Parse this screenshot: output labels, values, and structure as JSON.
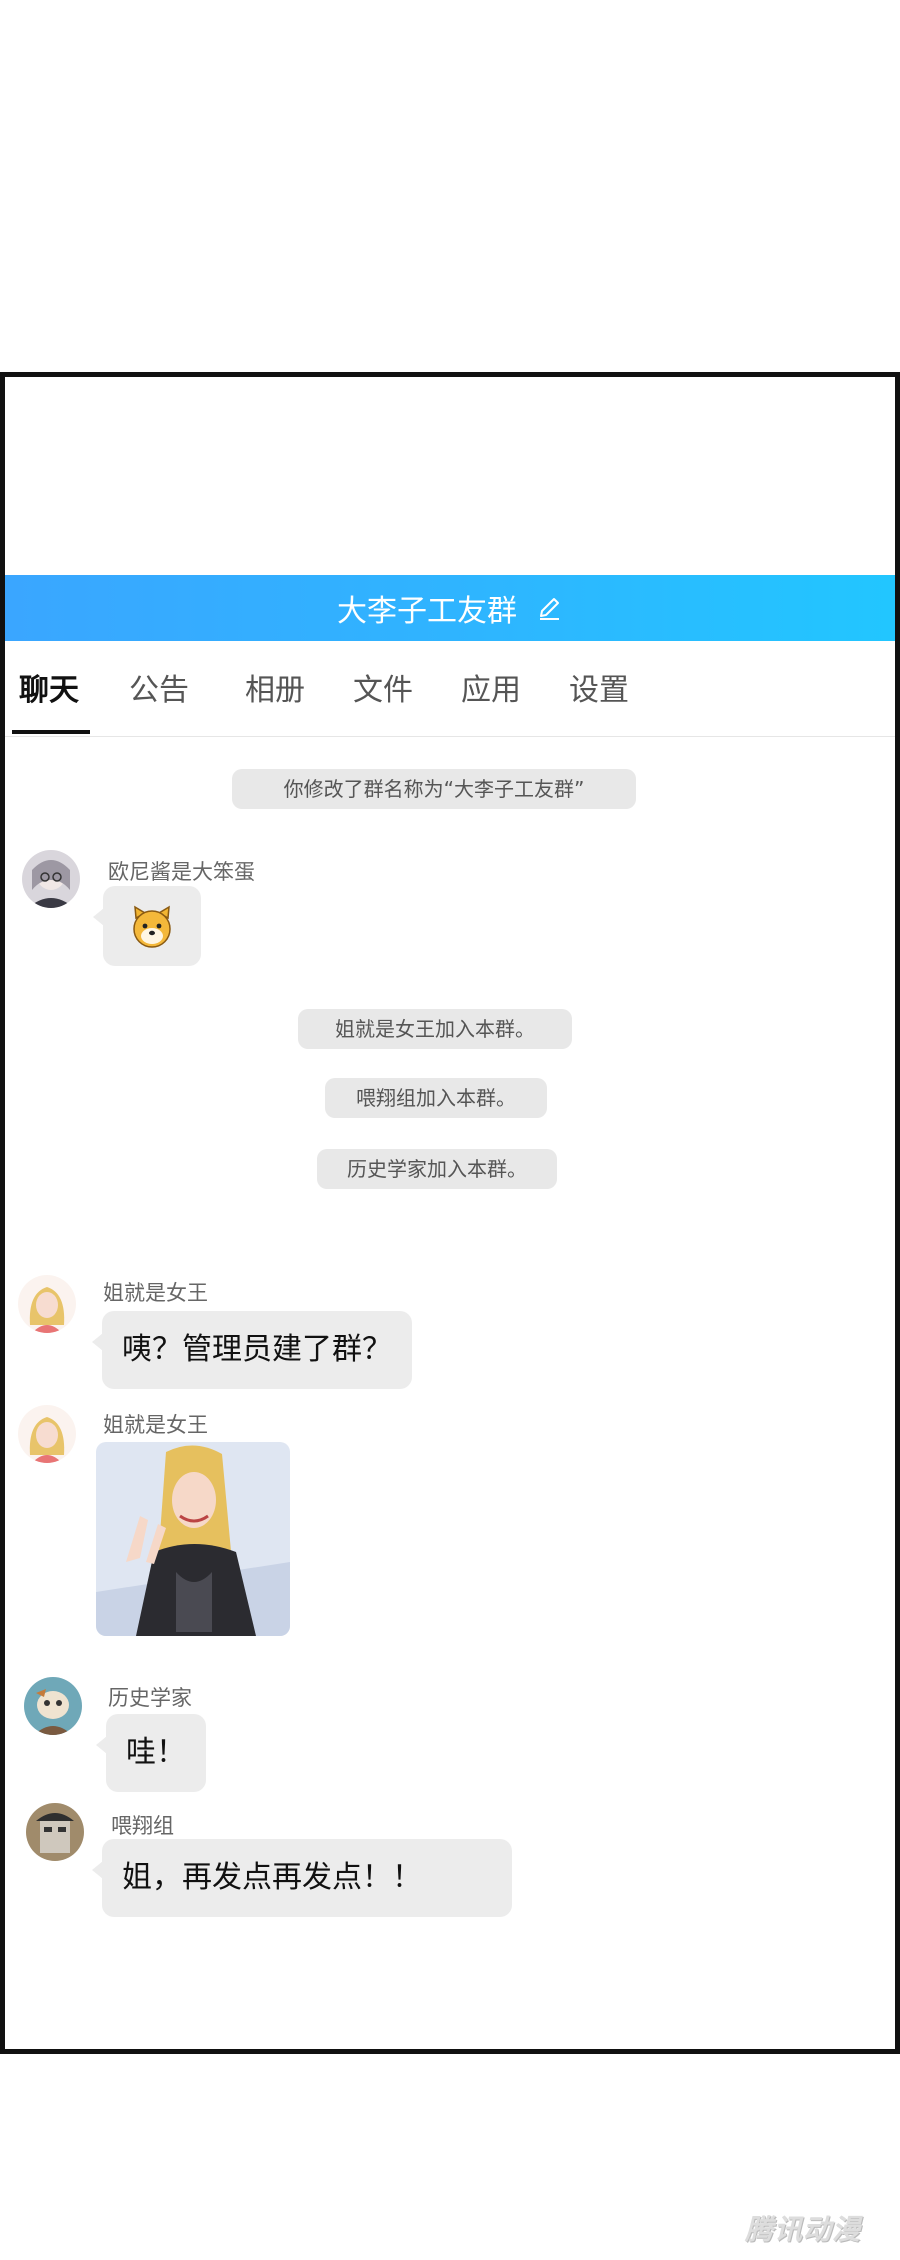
{
  "header": {
    "group_name": "大李子工友群"
  },
  "tabs": [
    "聊天",
    "公告",
    "相册",
    "文件",
    "应用",
    "设置"
  ],
  "messages": {
    "sys_rename": "你修改了群名称为“大李子工友群”",
    "m1_user": "欧尼酱是大笨蛋",
    "sys_join1": "姐就是女王加入本群。",
    "sys_join2": "喂翔组加入本群。",
    "sys_join3": "历史学家加入本群。",
    "m2_user": "姐就是女王",
    "m2_text": "咦？管理员建了群？",
    "m3_user": "姐就是女王",
    "m4_user": "历史学家",
    "m4_text": "哇！",
    "m5_user": "喂翔组",
    "m5_text": "姐，再发点再发点！！"
  },
  "watermark": "腾讯动漫",
  "colors": {
    "title_bar_start": "#3aa6ff",
    "title_bar_end": "#22c6ff",
    "bubble": "#ececec",
    "system_pill": "#e8e8e8"
  }
}
